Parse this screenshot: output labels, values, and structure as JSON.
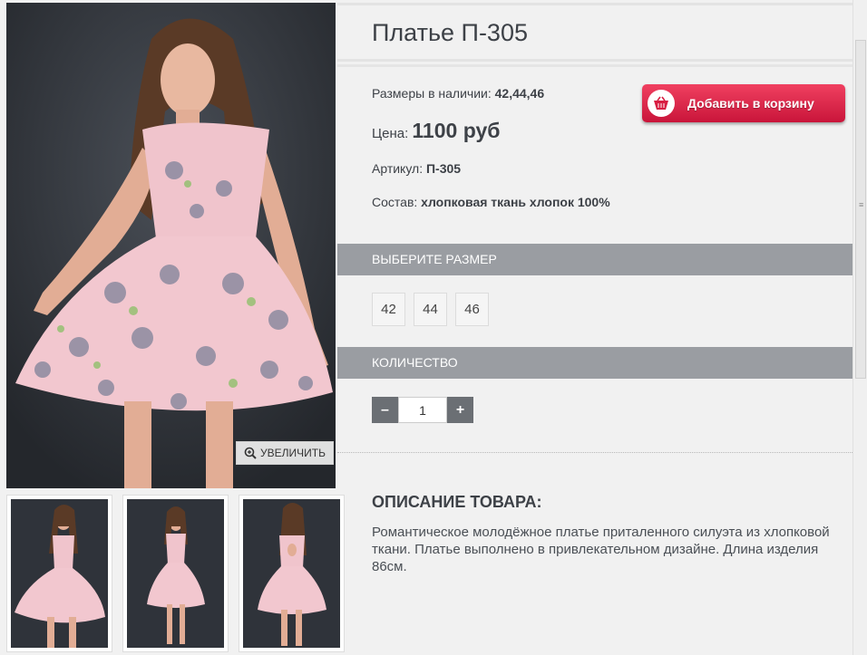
{
  "product": {
    "title": "Платье П-305",
    "sizes_label": "Размеры в наличии:",
    "sizes_value": "42,44,46",
    "price_label": "Цена:",
    "price_value": "1100 руб",
    "article_label": "Артикул:",
    "article_value": "П-305",
    "composition_label": "Состав:",
    "composition_value": "хлопковая ткань хлопок 100%"
  },
  "gallery": {
    "zoom_label": "УВЕЛИЧИТЬ"
  },
  "cart": {
    "add_label": "Добавить в корзину"
  },
  "size_select": {
    "header": "ВЫБЕРИТЕ РАЗМЕР",
    "options": [
      "42",
      "44",
      "46"
    ]
  },
  "quantity": {
    "header": "КОЛИЧЕСТВО",
    "minus": "–",
    "plus": "+",
    "value": "1"
  },
  "description": {
    "title": "ОПИСАНИЕ ТОВАРА:",
    "text": "Романтическое молодёжное платье приталенного силуэта из хлопковой ткани. Платье выполнено в привлекательном дизайне. Длина изделия 86см."
  },
  "colors": {
    "cart_button": "#e02a4c",
    "section_bar": "#9a9da2",
    "dress": "#f0c4cc",
    "photo_bg": "#2e3238"
  }
}
